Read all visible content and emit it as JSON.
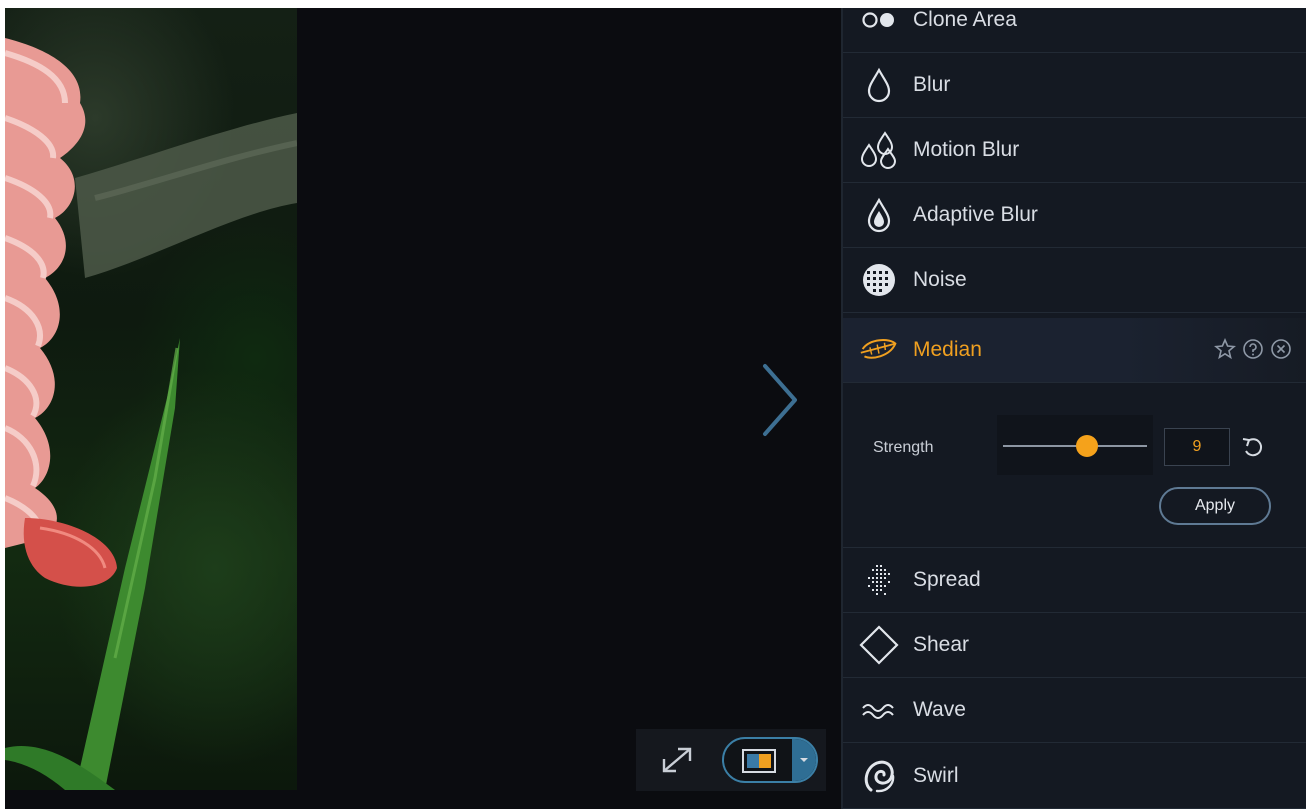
{
  "effects": {
    "items": [
      {
        "label": "Clone Area",
        "icon": "clone-area-icon"
      },
      {
        "label": "Blur",
        "icon": "blur-drop-icon"
      },
      {
        "label": "Motion Blur",
        "icon": "motion-blur-icon"
      },
      {
        "label": "Adaptive Blur",
        "icon": "adaptive-blur-icon"
      },
      {
        "label": "Noise",
        "icon": "noise-icon"
      },
      {
        "label": "Median",
        "icon": "median-feather-icon",
        "active": true
      },
      {
        "label": "Spread",
        "icon": "spread-icon"
      },
      {
        "label": "Shear",
        "icon": "shear-diamond-icon"
      },
      {
        "label": "Wave",
        "icon": "wave-icon"
      },
      {
        "label": "Swirl",
        "icon": "swirl-icon"
      }
    ],
    "active_actions": [
      "star-icon",
      "help-icon",
      "close-circle-icon"
    ]
  },
  "median_settings": {
    "strength_label": "Strength",
    "strength_value": "9",
    "strength_fraction": 0.58,
    "apply_label": "Apply"
  },
  "toolbar": {
    "fit_icon": "expand-arrows-icon",
    "compare_icon": "split-view-icon",
    "dropdown_icon": "chevron-down-icon"
  },
  "colors": {
    "accent": "#f0a020",
    "panel_bg": "#141922",
    "toggle_border": "#3b7fa6"
  }
}
